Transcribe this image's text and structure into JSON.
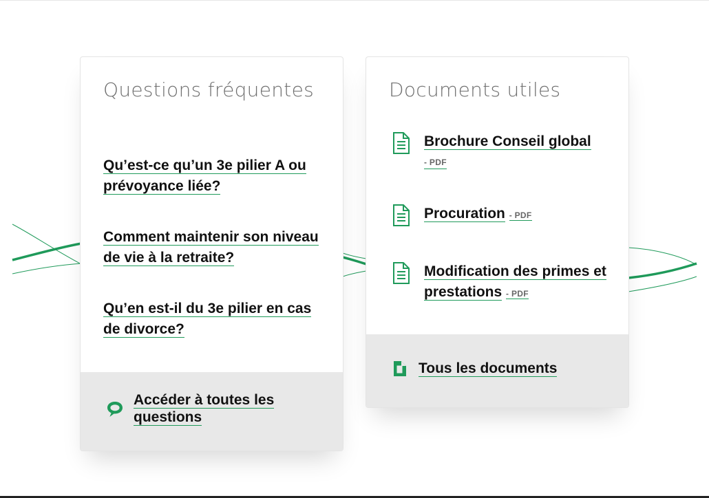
{
  "faq": {
    "title": "Questions fréquentes",
    "items": [
      {
        "label": "Qu’est-ce qu’un 3e pilier A ou prévoyance liée?"
      },
      {
        "label": "Comment maintenir son niveau de vie à la retraite?"
      },
      {
        "label": "Qu’en est-il du 3e pilier en cas de divorce?"
      }
    ],
    "footer": {
      "label": "Accéder à toutes les questions",
      "icon": "speech-bubble-icon"
    }
  },
  "docs": {
    "title": "Documents utiles",
    "items": [
      {
        "label": "Brochure Conseil global",
        "format": "- PDF",
        "icon": "document-icon"
      },
      {
        "label": "Procuration",
        "format": "- PDF",
        "icon": "document-icon"
      },
      {
        "label": "Modification des primes et prestations",
        "format": "- PDF",
        "icon": "document-icon"
      }
    ],
    "footer": {
      "label": "Tous les documents",
      "icon": "file-icon"
    }
  },
  "colors": {
    "accent": "#1f9a5a",
    "title_gray": "#6e6e6e",
    "footer_bg": "#e8e8e8",
    "text": "#111111"
  }
}
